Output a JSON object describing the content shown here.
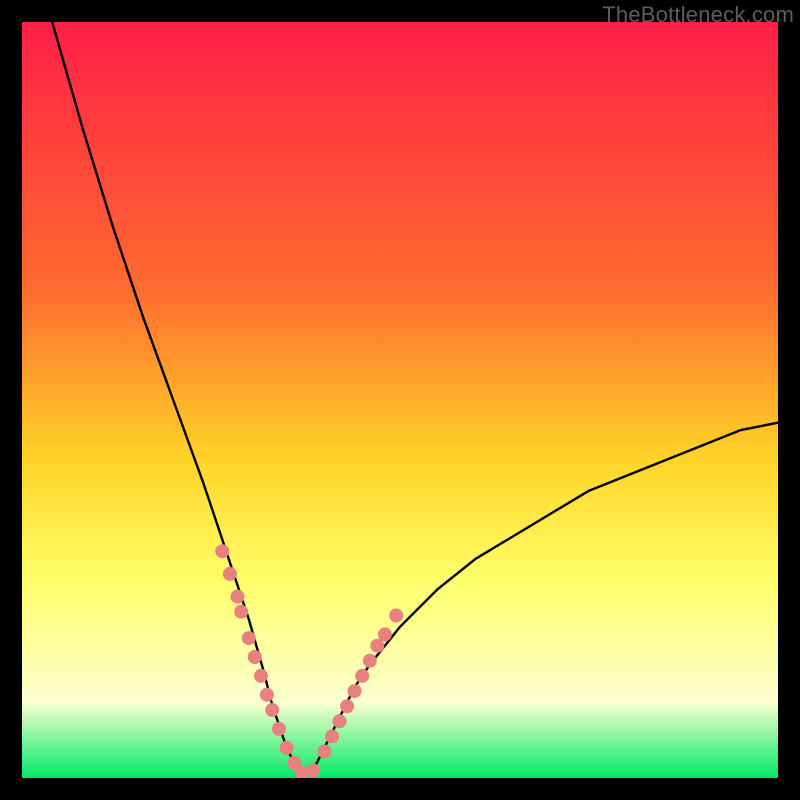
{
  "watermark": "TheBottleneck.com",
  "colors": {
    "bg": "#000000",
    "gradient_top": "#ff1f46",
    "gradient_mid1": "#ff6a2f",
    "gradient_mid2": "#ffd427",
    "gradient_mid3": "#ffff6b",
    "gradient_mid4": "#fbffd0",
    "gradient_bottom": "#00e865",
    "curve": "#000000",
    "marker": "#e98080"
  },
  "chart_data": {
    "type": "line",
    "title": "",
    "xlabel": "",
    "ylabel": "",
    "xlim": [
      0,
      100
    ],
    "ylim": [
      0,
      100
    ],
    "grid": false,
    "legend": false,
    "curve_comment": "V-shaped bottleneck curve; minimum ~0 near x≈37; rises steeply to ~100 at x≈0 and ~47 at x≈100 (values read from pixel positions).",
    "x": [
      4,
      8,
      12,
      16,
      20,
      24,
      26,
      28,
      30,
      32,
      33,
      34,
      35,
      36,
      37,
      38,
      39,
      40,
      41,
      42,
      44,
      46,
      50,
      55,
      60,
      65,
      70,
      75,
      80,
      85,
      90,
      95,
      100
    ],
    "y": [
      100,
      86,
      73,
      61,
      50,
      39,
      33,
      27,
      21,
      14,
      10,
      7,
      4,
      2,
      0.5,
      0.5,
      2,
      4,
      6,
      8,
      12,
      15,
      20,
      25,
      29,
      32,
      35,
      38,
      40,
      42,
      44,
      46,
      47
    ],
    "markers_comment": "Salmon dot clusters along lower part of the V near the vertex.",
    "markers": {
      "x": [
        26.5,
        27.5,
        28.5,
        29.0,
        30.0,
        30.8,
        31.6,
        32.4,
        33.1,
        34.0,
        35.0,
        36.0,
        37.0,
        38.5,
        40.0,
        41.0,
        42.0,
        43.0,
        44.0,
        45.0,
        46.0,
        47.0,
        48.0,
        49.5
      ],
      "y": [
        30.0,
        27.0,
        24.0,
        22.0,
        18.5,
        16.0,
        13.5,
        11.0,
        9.0,
        6.5,
        4.0,
        2.0,
        0.7,
        1.0,
        3.5,
        5.5,
        7.5,
        9.5,
        11.5,
        13.5,
        15.5,
        17.5,
        19.0,
        21.5
      ]
    }
  }
}
